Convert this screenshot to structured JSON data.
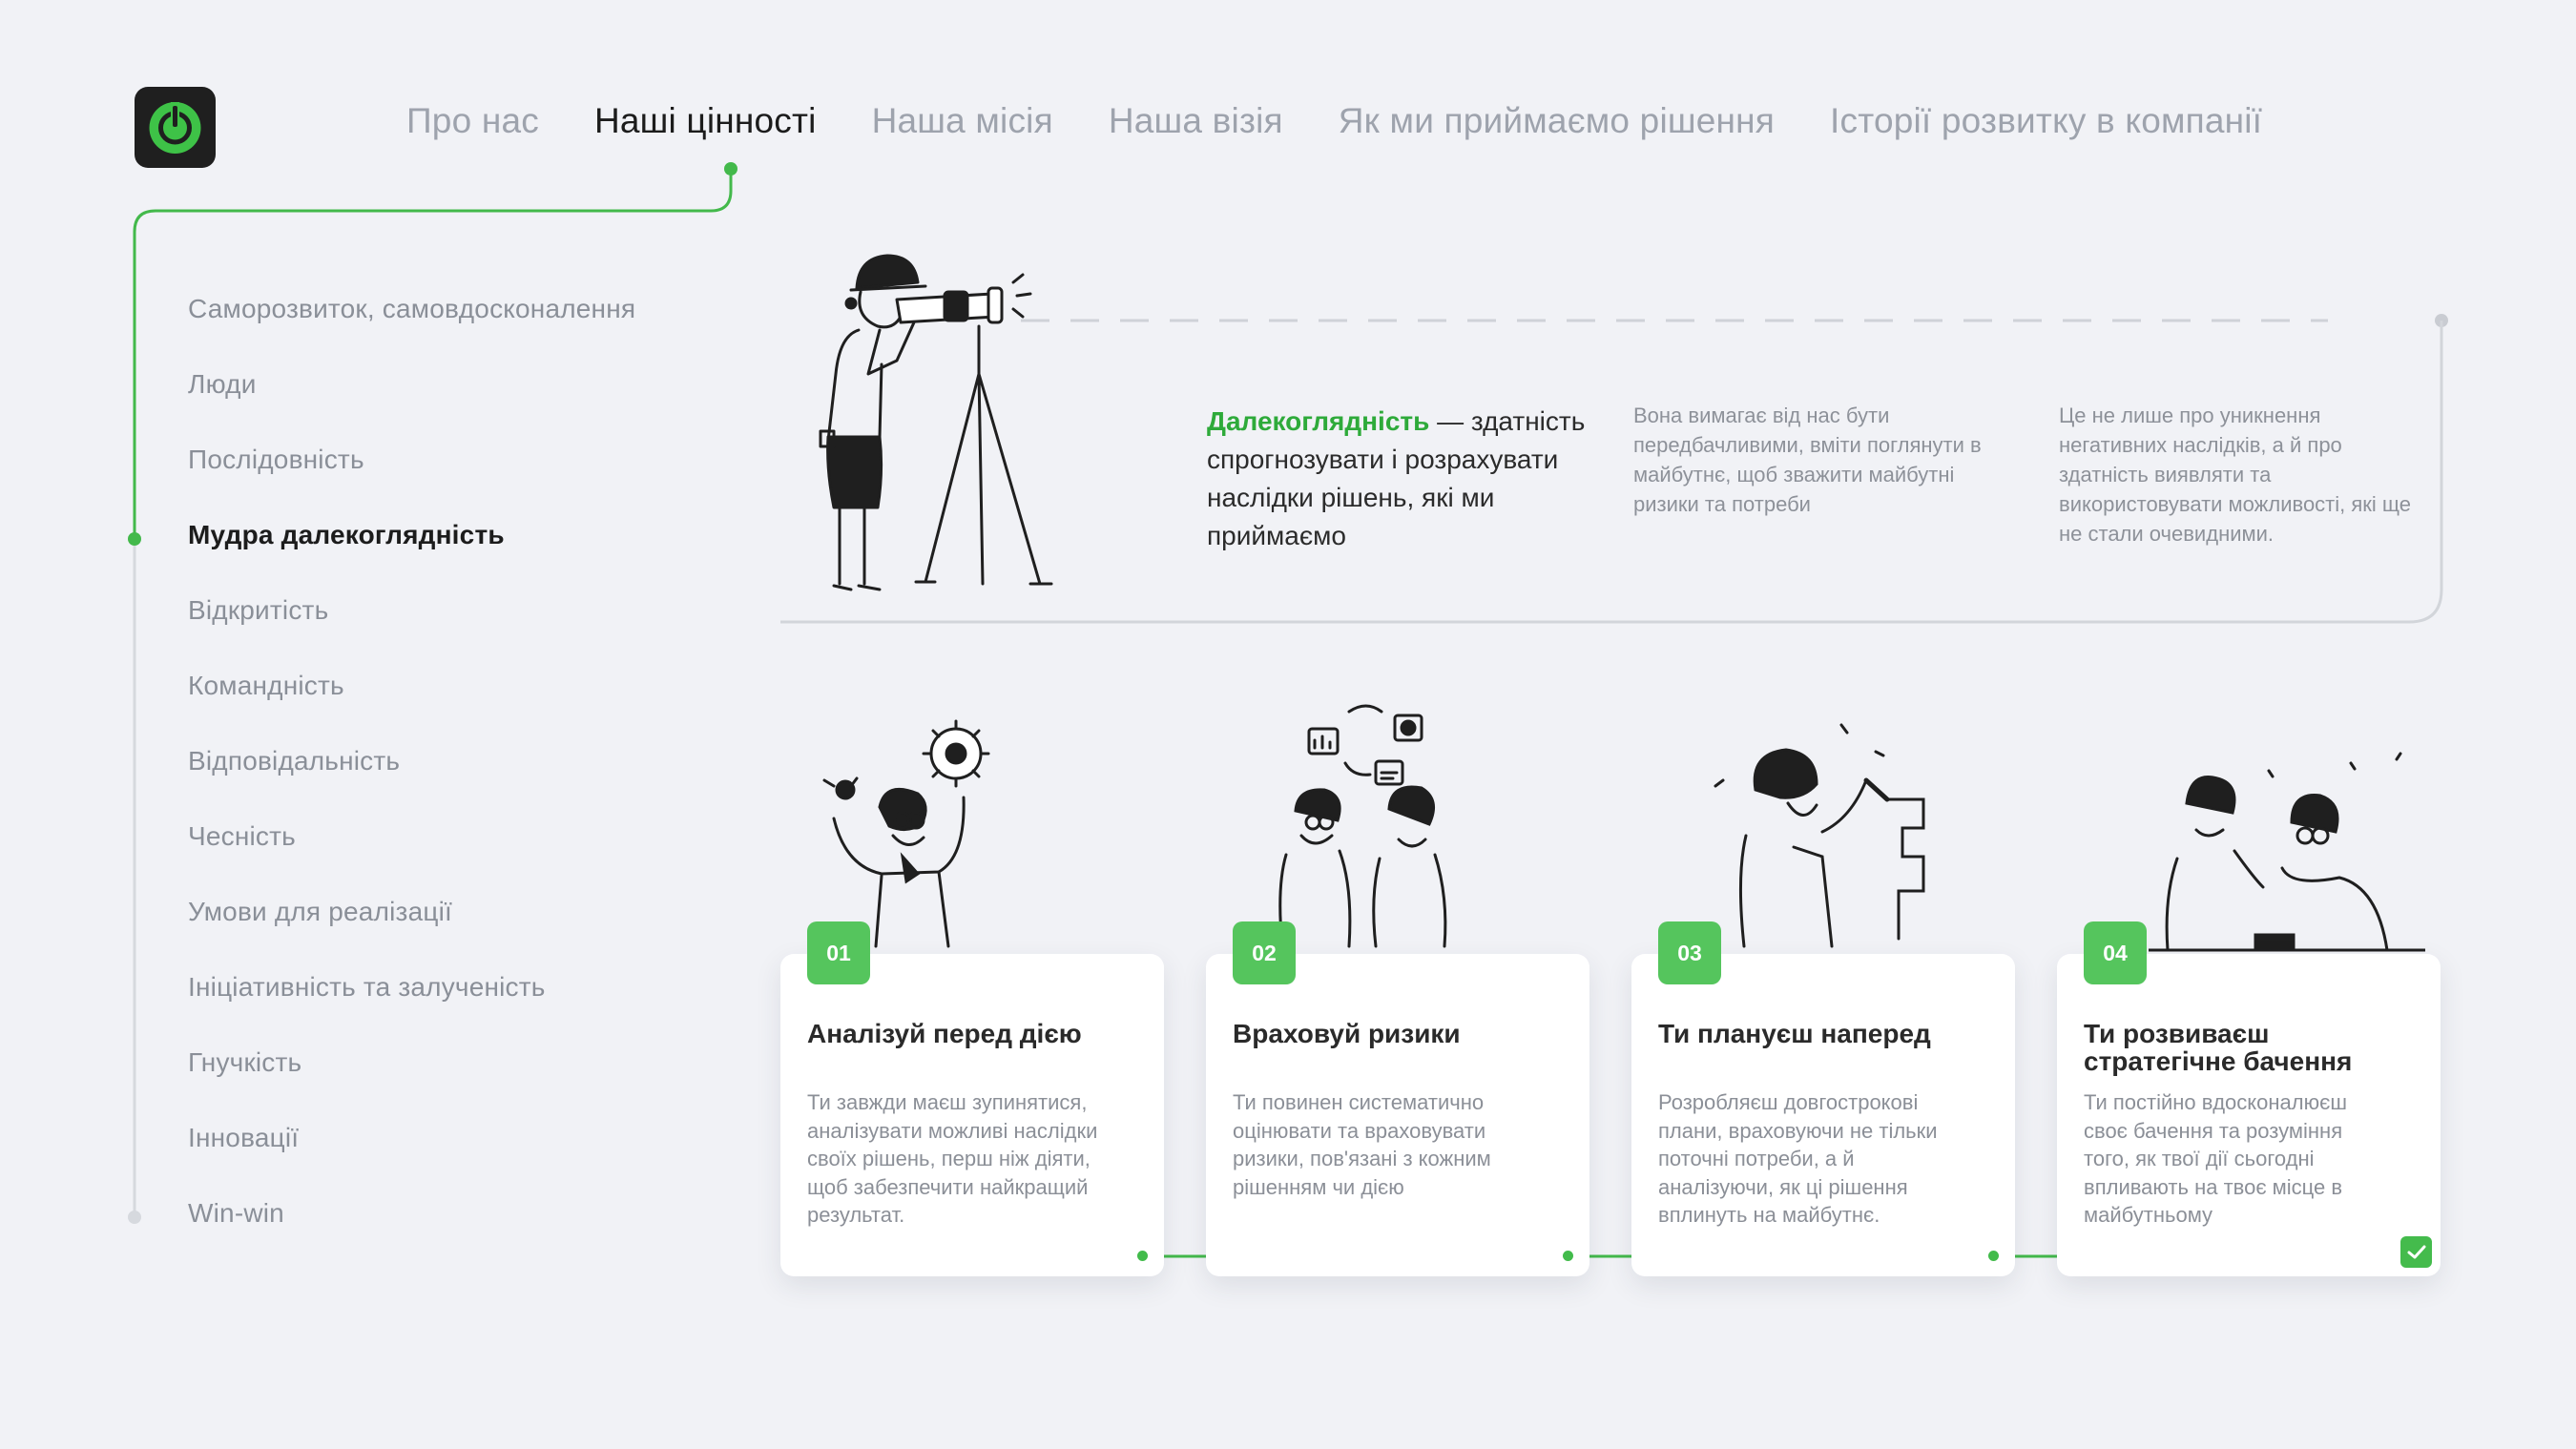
{
  "nav": {
    "tabs": [
      {
        "label": "Про нас",
        "active": false
      },
      {
        "label": "Наші цінності",
        "active": true
      },
      {
        "label": "Наша місія",
        "active": false
      },
      {
        "label": "Наша візія",
        "active": false
      },
      {
        "label": "Як ми приймаємо рішення",
        "active": false
      },
      {
        "label": "Історії розвитку в компанії",
        "active": false
      }
    ]
  },
  "sidebar": {
    "items": [
      {
        "label": "Саморозвиток, самовдосконалення",
        "active": false
      },
      {
        "label": "Люди",
        "active": false
      },
      {
        "label": "Послідовність",
        "active": false
      },
      {
        "label": "Мудра далекоглядність",
        "active": true
      },
      {
        "label": "Відкритість",
        "active": false
      },
      {
        "label": "Командність",
        "active": false
      },
      {
        "label": "Відповідальність",
        "active": false
      },
      {
        "label": "Чесність",
        "active": false
      },
      {
        "label": "Умови для реалізації",
        "active": false
      },
      {
        "label": "Ініціативність та залученість",
        "active": false
      },
      {
        "label": "Гнучкість",
        "active": false
      },
      {
        "label": "Інновації",
        "active": false
      },
      {
        "label": "Win-win",
        "active": false
      }
    ]
  },
  "hero": {
    "term": "Далекоглядність",
    "definition": " — здатність спрогнозувати і розрахувати наслідки рішень, які ми приймаємо",
    "note1": "Вона вимагає від нас бути передбачливими, вміти поглянути в майбутнє, щоб зважити майбутні ризики та потреби",
    "note2": "Це не лише про уникнення негативних наслідків, а й про здатність виявляти та використовувати можливості, які ще не стали очевидними."
  },
  "cards": [
    {
      "number": "01",
      "title": "Аналізуй перед дією",
      "body": "Ти завжди маєш зупинятися, аналізувати можливі наслідки своїх рішень, перш ніж діяти, щоб забезпечити найкращий результат."
    },
    {
      "number": "02",
      "title": "Враховуй ризики",
      "body": "Ти повинен систематично оцінювати та враховувати ризики, пов'язані з кожним рішенням чи дією"
    },
    {
      "number": "03",
      "title": "Ти плануєш наперед",
      "body": "Розробляєш довгострокові плани, враховуючи не тільки поточні потреби, а й аналізуючи, як ці рішення вплинуть на майбутнє."
    },
    {
      "number": "04",
      "title": "Ти розвиваєш стратегічне бачення",
      "body": "Ти постійно вдосконалюєш своє бачення та розуміння того, як твої дії сьогодні впливають на твоє місце в майбутньому"
    }
  ],
  "colors": {
    "accent": "#44bb4c",
    "background": "#f1f2f6",
    "inactive_text": "#9ea3ad"
  },
  "icons": [
    "power-icon",
    "checkmark-icon"
  ]
}
